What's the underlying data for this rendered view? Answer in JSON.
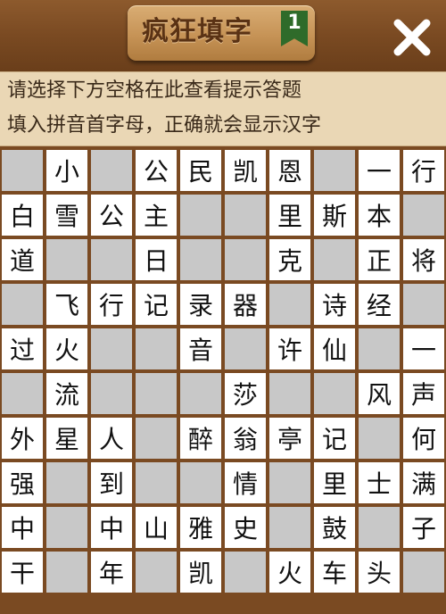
{
  "header": {
    "title": "疯狂填字",
    "level": "1"
  },
  "hint": {
    "line1": "请选择下方空格在此查看提示答题",
    "line2": "填入拼音首字母，正确就会显示汉字"
  },
  "colors": {
    "wood": "#7a4a22",
    "blocked": "#c8c8c8",
    "open": "#ffffff",
    "hint_bg": "#ead7b5",
    "badge": "#2f6b2a"
  },
  "icons": {
    "close": "close-x-icon",
    "level_badge": "bookmark-ribbon-icon"
  },
  "grid": {
    "rows": [
      [
        "#",
        "小",
        "#",
        "公",
        "民",
        "凯",
        "恩",
        "#",
        "一",
        "行"
      ],
      [
        "白",
        "雪",
        "公",
        "主",
        "#",
        "#",
        "里",
        "斯",
        "本",
        "#"
      ],
      [
        "道",
        "#",
        "#",
        "日",
        "#",
        "#",
        "克",
        "#",
        "正",
        "将"
      ],
      [
        "#",
        "飞",
        "行",
        "记",
        "录",
        "器",
        "#",
        "诗",
        "经",
        "#"
      ],
      [
        "过",
        "火",
        "#",
        "#",
        "音",
        "#",
        "许",
        "仙",
        "#",
        "一"
      ],
      [
        "#",
        "流",
        "#",
        "#",
        "#",
        "莎",
        "#",
        "#",
        "风",
        "声"
      ],
      [
        "外",
        "星",
        "人",
        "#",
        "醉",
        "翁",
        "亭",
        "记",
        "#",
        "何"
      ],
      [
        "强",
        "#",
        "到",
        "#",
        "#",
        "情",
        "#",
        "里",
        "士",
        "满"
      ],
      [
        "中",
        "#",
        "中",
        "山",
        "雅",
        "史",
        "#",
        "鼓",
        "#",
        "子"
      ],
      [
        "干",
        "#",
        "年",
        "#",
        "凯",
        "#",
        "火",
        "车",
        "头",
        "#"
      ]
    ]
  }
}
